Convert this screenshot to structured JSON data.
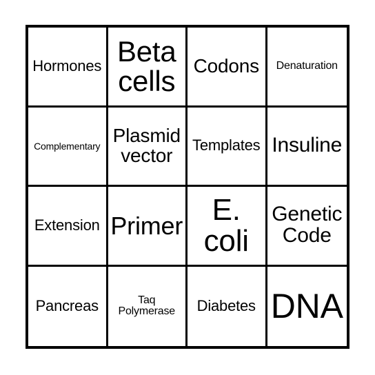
{
  "card": {
    "type": "bingo-card",
    "columns": 4,
    "rows": 4,
    "colors": {
      "background": "#ffffff",
      "border": "#000000",
      "text": "#000000"
    },
    "cells": [
      {
        "label": "Hormones",
        "row": 1,
        "col": 1,
        "size": "fs-md",
        "lines": 1
      },
      {
        "label": "Beta cells",
        "row": 1,
        "col": 2,
        "size": "fs-3xl",
        "lines": 2
      },
      {
        "label": "Codons",
        "row": 1,
        "col": 3,
        "size": "fs-lg",
        "lines": 1
      },
      {
        "label": "Denaturation",
        "row": 1,
        "col": 4,
        "size": "fs-sm",
        "lines": 1
      },
      {
        "label": "Complementary",
        "row": 2,
        "col": 1,
        "size": "fs-xs",
        "lines": 1
      },
      {
        "label": "Plasmid vector",
        "row": 2,
        "col": 2,
        "size": "fs-lg",
        "lines": 2
      },
      {
        "label": "Templates",
        "row": 2,
        "col": 3,
        "size": "fs-md",
        "lines": 1
      },
      {
        "label": "Insuline",
        "row": 2,
        "col": 4,
        "size": "fs-xl",
        "lines": 1
      },
      {
        "label": "Extension",
        "row": 3,
        "col": 1,
        "size": "fs-md",
        "lines": 1
      },
      {
        "label": "Primer",
        "row": 3,
        "col": 2,
        "size": "fs-2xl",
        "lines": 1
      },
      {
        "label": "E. coli",
        "row": 3,
        "col": 3,
        "size": "fs-4xl",
        "lines": 2
      },
      {
        "label": "Genetic Code",
        "row": 3,
        "col": 4,
        "size": "fs-xl",
        "lines": 2
      },
      {
        "label": "Pancreas",
        "row": 4,
        "col": 1,
        "size": "fs-md",
        "lines": 1
      },
      {
        "label": "Taq Polymerase",
        "row": 4,
        "col": 2,
        "size": "fs-sm",
        "lines": 2
      },
      {
        "label": "Diabetes",
        "row": 4,
        "col": 3,
        "size": "fs-md",
        "lines": 1
      },
      {
        "label": "DNA",
        "row": 4,
        "col": 4,
        "size": "fs-5xl",
        "lines": 1
      }
    ]
  }
}
